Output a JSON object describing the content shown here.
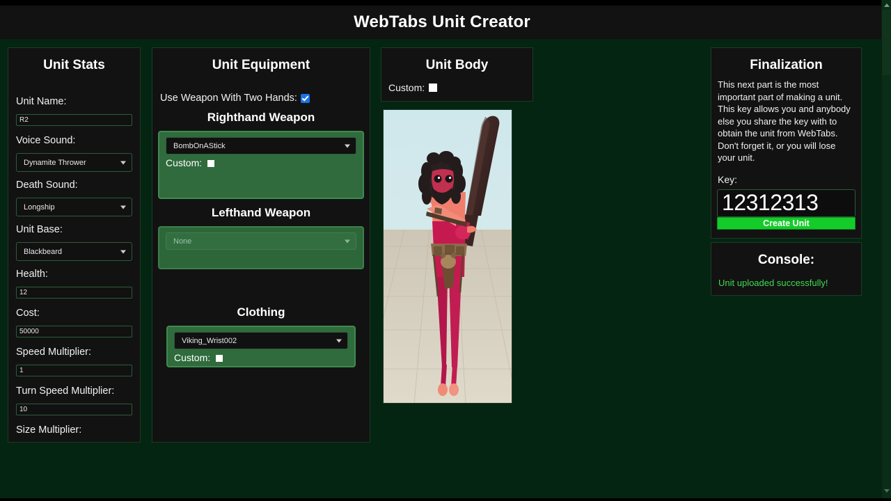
{
  "app": {
    "title": "WebTabs Unit Creator"
  },
  "unit_stats": {
    "title": "Unit Stats",
    "fields": [
      {
        "label": "Unit Name:",
        "type": "text",
        "value": "R2"
      },
      {
        "label": "Voice Sound:",
        "type": "select",
        "value": "Dynamite Thrower"
      },
      {
        "label": "Death Sound:",
        "type": "select",
        "value": "Longship"
      },
      {
        "label": "Unit Base:",
        "type": "select",
        "value": "Blackbeard"
      },
      {
        "label": "Health:",
        "type": "text",
        "value": "12"
      },
      {
        "label": "Cost:",
        "type": "text",
        "value": "50000"
      },
      {
        "label": "Speed Multiplier:",
        "type": "text",
        "value": "1"
      },
      {
        "label": "Turn Speed Multiplier:",
        "type": "text",
        "value": "10"
      }
    ],
    "cutoff_label": "Size Multiplier:"
  },
  "unit_equipment": {
    "title": "Unit Equipment",
    "two_hands_label": "Use Weapon With Two Hands:",
    "two_hands_checked": true,
    "righthand": {
      "heading": "Righthand Weapon",
      "value": "BombOnAStick",
      "custom_label": "Custom:",
      "custom_checked": false
    },
    "lefthand": {
      "heading": "Lefthand Weapon",
      "value": "None"
    },
    "clothing": {
      "heading": "Clothing",
      "value": "Viking_Wrist002",
      "custom_label": "Custom:",
      "custom_checked": false
    }
  },
  "unit_body": {
    "title": "Unit Body",
    "custom_label": "Custom:",
    "custom_checked": false
  },
  "finalization": {
    "title": "Finalization",
    "description": "This next part is the most important part of making a unit.\nThis key allows you and anybody else you share the key with to obtain the unit from WebTabs.\nDon't forget it, or you will lose your unit.",
    "key_label": "Key:",
    "key_value": "12312313",
    "create_button": "Create Unit"
  },
  "console": {
    "title": "Console:",
    "message": "Unit uploaded successfully!"
  },
  "colors": {
    "background": "#042512",
    "panel": "#121212",
    "panel_border": "#1d3a26",
    "accent_green": "#2f6b3c",
    "button_green": "#14cc29",
    "console_text": "#3ddc4f",
    "checkbox_blue": "#1a73e8"
  }
}
